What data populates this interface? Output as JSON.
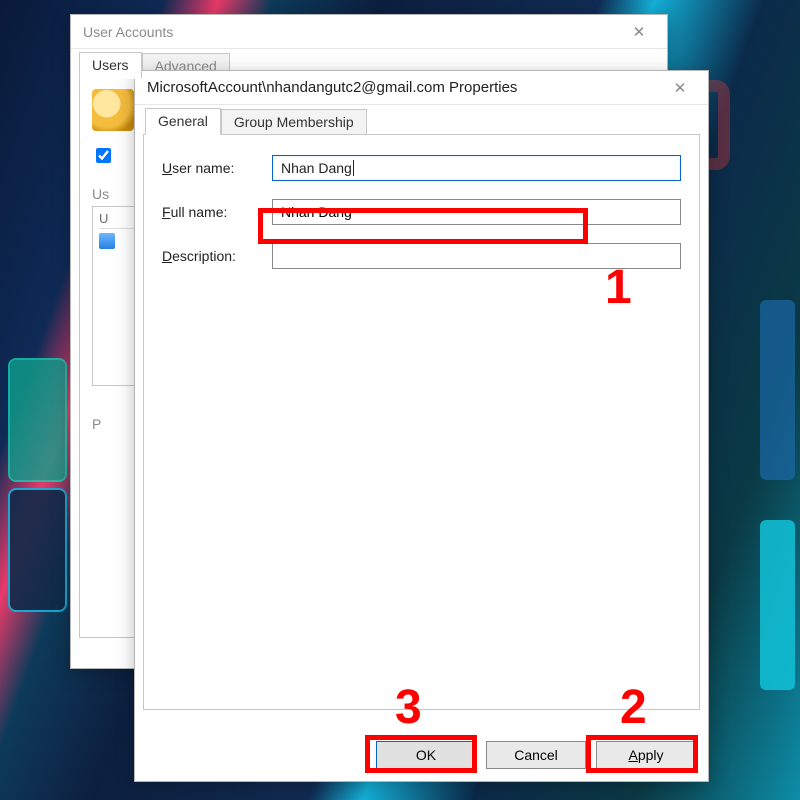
{
  "back_window": {
    "title": "User Accounts",
    "tabs": {
      "users": "Users",
      "advanced": "Advanced"
    },
    "checkbox_label": "",
    "users_list_label": "Us",
    "list_header": "U",
    "password_label": "P"
  },
  "prop_window": {
    "title": "MicrosoftAccount\\nhandangutc2@gmail.com Properties",
    "tabs": {
      "general": "General",
      "group": "Group Membership"
    },
    "labels": {
      "username_pre": "U",
      "username_rest": "ser name:",
      "fullname_pre": "F",
      "fullname_rest": "ull name:",
      "description_pre": "D",
      "description_rest": "escription:"
    },
    "values": {
      "username": "Nhan Dang",
      "fullname": "Nhan Dang",
      "description": ""
    },
    "buttons": {
      "ok": "OK",
      "cancel": "Cancel",
      "apply_pre": "A",
      "apply_rest": "pply"
    }
  },
  "annotations": {
    "n1": "1",
    "n2": "2",
    "n3": "3"
  }
}
